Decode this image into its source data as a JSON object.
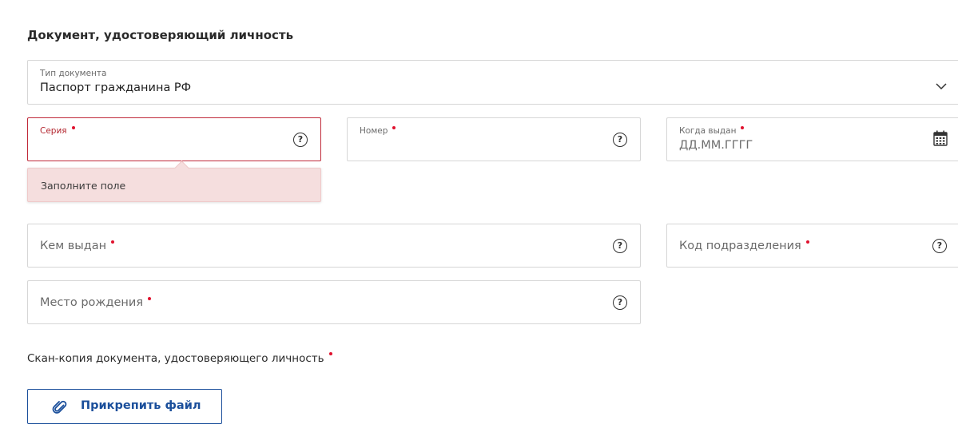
{
  "section": {
    "title": "Документ, удостоверяющий личность"
  },
  "document_type": {
    "label": "Тип документа",
    "value": "Паспорт гражданина РФ",
    "icon": "chevron-down-icon"
  },
  "series": {
    "label": "Серия",
    "value": "",
    "required": true,
    "state": "error",
    "error_message": "Заполните поле",
    "icon": "help-icon"
  },
  "number": {
    "label": "Номер",
    "value": "",
    "required": true,
    "icon": "help-icon"
  },
  "issue_date": {
    "label": "Когда выдан",
    "placeholder": "ДД.ММ.ГГГГ",
    "required": true,
    "icon": "calendar-icon"
  },
  "issued_by": {
    "label": "Кем выдан",
    "required": true,
    "icon": "help-icon"
  },
  "department_code": {
    "label": "Код подразделения",
    "required": true,
    "icon": "help-icon"
  },
  "birthplace": {
    "label": "Место рождения",
    "required": true,
    "icon": "help-icon"
  },
  "scan": {
    "label": "Скан-копия документа, удостоверяющего личность",
    "required": true,
    "button_label": "Прикрепить файл",
    "button_icon": "paperclip-icon"
  },
  "help_symbol": "?",
  "colors": {
    "error_border": "#c02a3a",
    "error_tooltip_bg": "#f5dede",
    "required_dot": "#e0112e",
    "accent": "#1b4f9b"
  }
}
